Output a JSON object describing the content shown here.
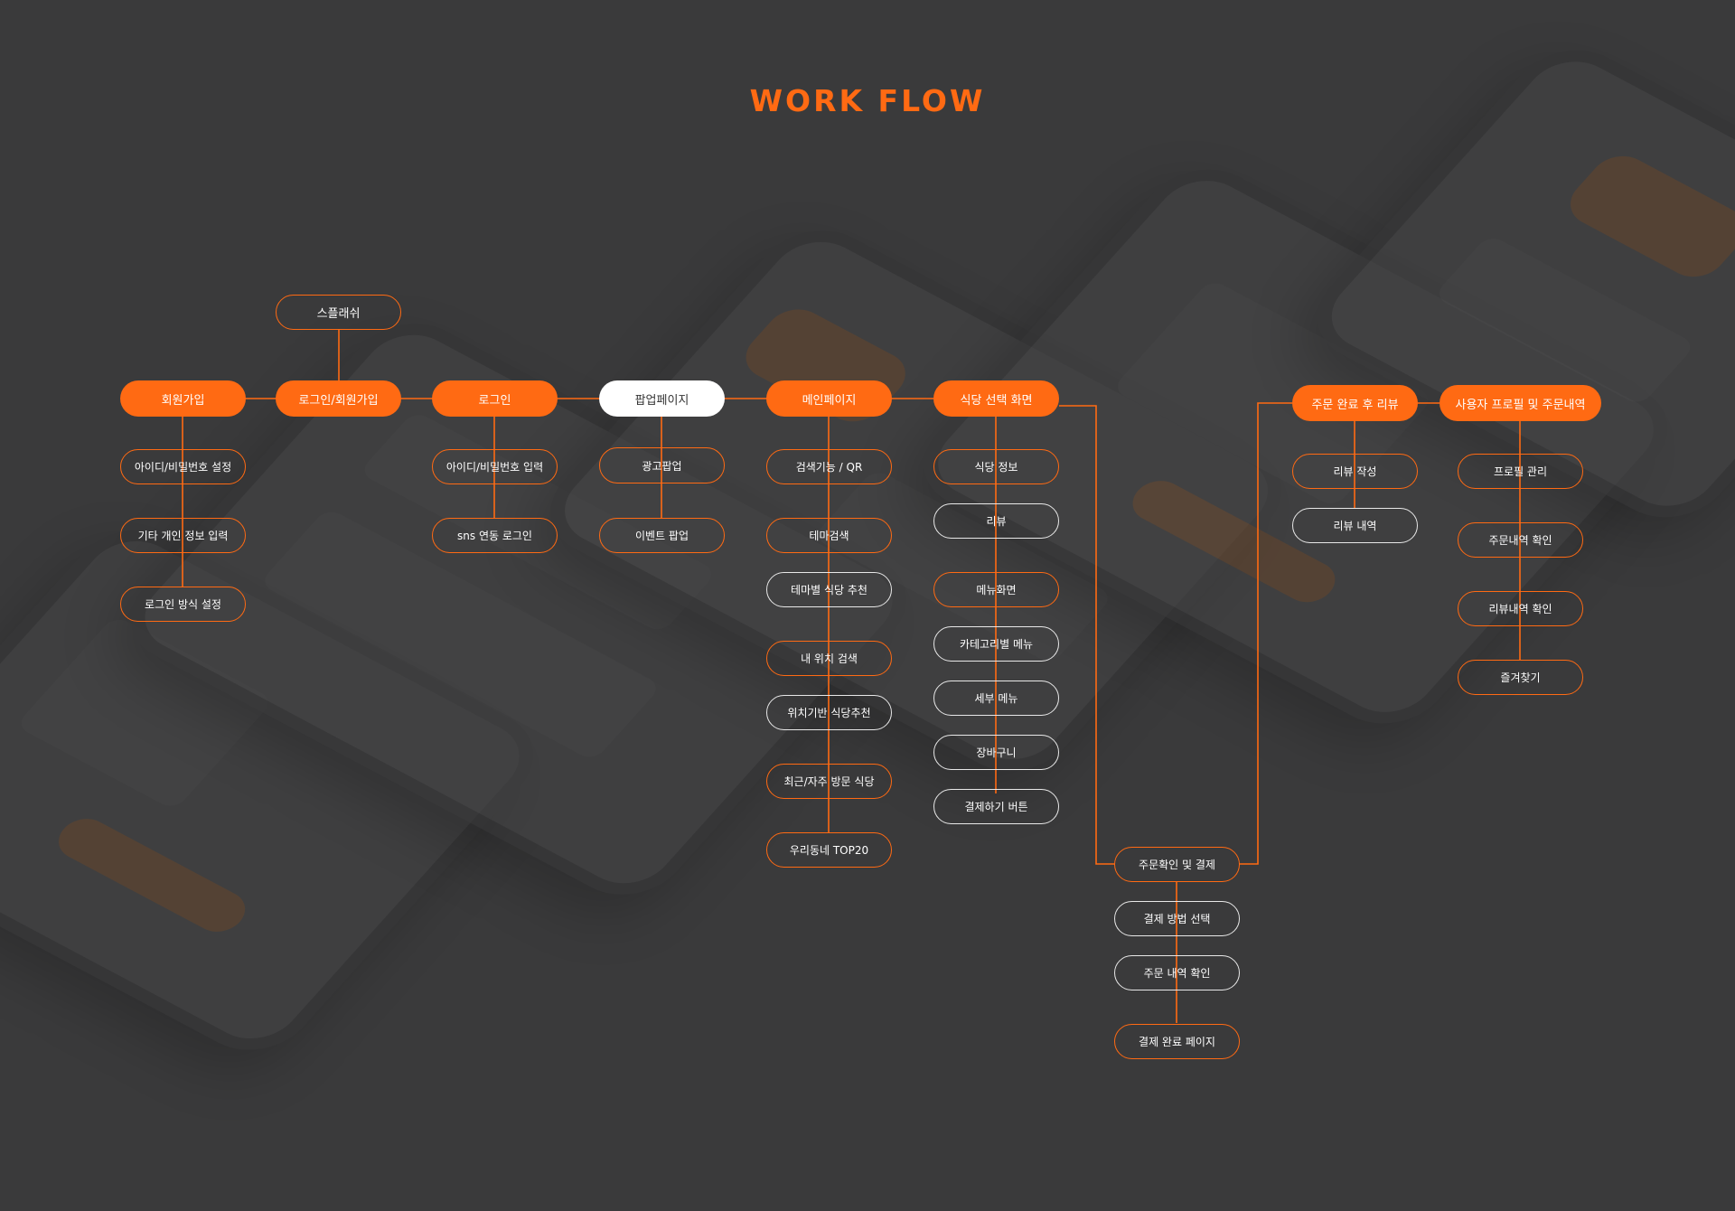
{
  "title": "WORK FLOW",
  "colors": {
    "accent": "#ff6a13",
    "background": "#3a3a3b",
    "white": "#ffffff"
  },
  "nodes": {
    "splash": "스플래쉬",
    "signup": "회원가입",
    "login_signup": "로그인/회원가입",
    "login": "로그인",
    "popup": "팝업페이지",
    "main": "메인페이지",
    "restaurant": "식당 선택 화면",
    "review_after": "주문 완료 후 리뷰",
    "profile": "사용자 프로필 및 주문내역",
    "signup_id": "아이디/비밀번호 설정",
    "signup_info": "기타 개인 정보 입력",
    "signup_method": "로그인 방식 설정",
    "login_id": "아이디/비밀번호 입력",
    "login_sns": "sns 연동 로그인",
    "popup_ad": "광고팝업",
    "popup_event": "이벤트 팝업",
    "main_search": "검색기능 / QR",
    "main_theme": "테마검색",
    "main_theme_rec": "테마별 식당 추천",
    "main_myloc": "내 위치 검색",
    "main_locrec": "위치기반 식당추천",
    "main_recent": "최근/자주 방문 식당",
    "main_top20": "우리동네 TOP20",
    "rest_info": "식당 정보",
    "rest_review": "리뷰",
    "rest_menu": "메뉴화면",
    "rest_category": "카테고리별 메뉴",
    "rest_detail": "세부 메뉴",
    "rest_cart": "장바구니",
    "rest_pay_btn": "결제하기 버튼",
    "order_confirm": "주문확인 및 결제",
    "pay_method": "결제 방법 선택",
    "order_check": "주문 내역 확인",
    "pay_done": "결제 완료 페이지",
    "review_write": "리뷰 작성",
    "review_list": "리뷰 내역",
    "profile_manage": "프로필 관리",
    "profile_orders": "주문내역 확인",
    "profile_reviews": "리뷰내역 확인",
    "profile_fav": "즐겨찾기"
  }
}
